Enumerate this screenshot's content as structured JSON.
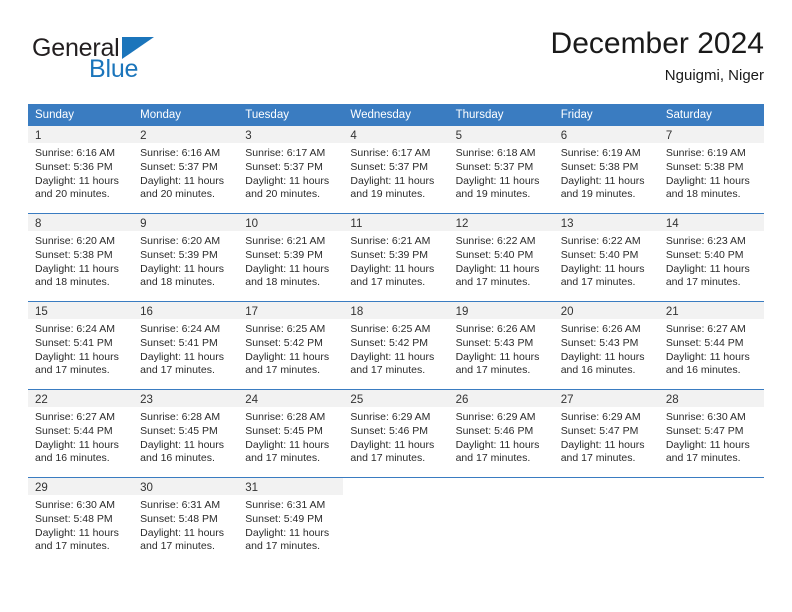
{
  "brand": {
    "name_part1": "General",
    "name_part2": "Blue",
    "color_dark": "#231f20",
    "color_blue": "#1b75bb"
  },
  "header": {
    "title": "December 2024",
    "subtitle": "Nguigmi, Niger"
  },
  "calendar": {
    "header_bg": "#3a7cc1",
    "daynum_bg": "#f2f2f2",
    "weekdays": [
      "Sunday",
      "Monday",
      "Tuesday",
      "Wednesday",
      "Thursday",
      "Friday",
      "Saturday"
    ],
    "weeks": [
      [
        {
          "day": "1",
          "sunrise": "Sunrise: 6:16 AM",
          "sunset": "Sunset: 5:36 PM",
          "daylight1": "Daylight: 11 hours",
          "daylight2": "and 20 minutes."
        },
        {
          "day": "2",
          "sunrise": "Sunrise: 6:16 AM",
          "sunset": "Sunset: 5:37 PM",
          "daylight1": "Daylight: 11 hours",
          "daylight2": "and 20 minutes."
        },
        {
          "day": "3",
          "sunrise": "Sunrise: 6:17 AM",
          "sunset": "Sunset: 5:37 PM",
          "daylight1": "Daylight: 11 hours",
          "daylight2": "and 20 minutes."
        },
        {
          "day": "4",
          "sunrise": "Sunrise: 6:17 AM",
          "sunset": "Sunset: 5:37 PM",
          "daylight1": "Daylight: 11 hours",
          "daylight2": "and 19 minutes."
        },
        {
          "day": "5",
          "sunrise": "Sunrise: 6:18 AM",
          "sunset": "Sunset: 5:37 PM",
          "daylight1": "Daylight: 11 hours",
          "daylight2": "and 19 minutes."
        },
        {
          "day": "6",
          "sunrise": "Sunrise: 6:19 AM",
          "sunset": "Sunset: 5:38 PM",
          "daylight1": "Daylight: 11 hours",
          "daylight2": "and 19 minutes."
        },
        {
          "day": "7",
          "sunrise": "Sunrise: 6:19 AM",
          "sunset": "Sunset: 5:38 PM",
          "daylight1": "Daylight: 11 hours",
          "daylight2": "and 18 minutes."
        }
      ],
      [
        {
          "day": "8",
          "sunrise": "Sunrise: 6:20 AM",
          "sunset": "Sunset: 5:38 PM",
          "daylight1": "Daylight: 11 hours",
          "daylight2": "and 18 minutes."
        },
        {
          "day": "9",
          "sunrise": "Sunrise: 6:20 AM",
          "sunset": "Sunset: 5:39 PM",
          "daylight1": "Daylight: 11 hours",
          "daylight2": "and 18 minutes."
        },
        {
          "day": "10",
          "sunrise": "Sunrise: 6:21 AM",
          "sunset": "Sunset: 5:39 PM",
          "daylight1": "Daylight: 11 hours",
          "daylight2": "and 18 minutes."
        },
        {
          "day": "11",
          "sunrise": "Sunrise: 6:21 AM",
          "sunset": "Sunset: 5:39 PM",
          "daylight1": "Daylight: 11 hours",
          "daylight2": "and 17 minutes."
        },
        {
          "day": "12",
          "sunrise": "Sunrise: 6:22 AM",
          "sunset": "Sunset: 5:40 PM",
          "daylight1": "Daylight: 11 hours",
          "daylight2": "and 17 minutes."
        },
        {
          "day": "13",
          "sunrise": "Sunrise: 6:22 AM",
          "sunset": "Sunset: 5:40 PM",
          "daylight1": "Daylight: 11 hours",
          "daylight2": "and 17 minutes."
        },
        {
          "day": "14",
          "sunrise": "Sunrise: 6:23 AM",
          "sunset": "Sunset: 5:40 PM",
          "daylight1": "Daylight: 11 hours",
          "daylight2": "and 17 minutes."
        }
      ],
      [
        {
          "day": "15",
          "sunrise": "Sunrise: 6:24 AM",
          "sunset": "Sunset: 5:41 PM",
          "daylight1": "Daylight: 11 hours",
          "daylight2": "and 17 minutes."
        },
        {
          "day": "16",
          "sunrise": "Sunrise: 6:24 AM",
          "sunset": "Sunset: 5:41 PM",
          "daylight1": "Daylight: 11 hours",
          "daylight2": "and 17 minutes."
        },
        {
          "day": "17",
          "sunrise": "Sunrise: 6:25 AM",
          "sunset": "Sunset: 5:42 PM",
          "daylight1": "Daylight: 11 hours",
          "daylight2": "and 17 minutes."
        },
        {
          "day": "18",
          "sunrise": "Sunrise: 6:25 AM",
          "sunset": "Sunset: 5:42 PM",
          "daylight1": "Daylight: 11 hours",
          "daylight2": "and 17 minutes."
        },
        {
          "day": "19",
          "sunrise": "Sunrise: 6:26 AM",
          "sunset": "Sunset: 5:43 PM",
          "daylight1": "Daylight: 11 hours",
          "daylight2": "and 17 minutes."
        },
        {
          "day": "20",
          "sunrise": "Sunrise: 6:26 AM",
          "sunset": "Sunset: 5:43 PM",
          "daylight1": "Daylight: 11 hours",
          "daylight2": "and 16 minutes."
        },
        {
          "day": "21",
          "sunrise": "Sunrise: 6:27 AM",
          "sunset": "Sunset: 5:44 PM",
          "daylight1": "Daylight: 11 hours",
          "daylight2": "and 16 minutes."
        }
      ],
      [
        {
          "day": "22",
          "sunrise": "Sunrise: 6:27 AM",
          "sunset": "Sunset: 5:44 PM",
          "daylight1": "Daylight: 11 hours",
          "daylight2": "and 16 minutes."
        },
        {
          "day": "23",
          "sunrise": "Sunrise: 6:28 AM",
          "sunset": "Sunset: 5:45 PM",
          "daylight1": "Daylight: 11 hours",
          "daylight2": "and 16 minutes."
        },
        {
          "day": "24",
          "sunrise": "Sunrise: 6:28 AM",
          "sunset": "Sunset: 5:45 PM",
          "daylight1": "Daylight: 11 hours",
          "daylight2": "and 17 minutes."
        },
        {
          "day": "25",
          "sunrise": "Sunrise: 6:29 AM",
          "sunset": "Sunset: 5:46 PM",
          "daylight1": "Daylight: 11 hours",
          "daylight2": "and 17 minutes."
        },
        {
          "day": "26",
          "sunrise": "Sunrise: 6:29 AM",
          "sunset": "Sunset: 5:46 PM",
          "daylight1": "Daylight: 11 hours",
          "daylight2": "and 17 minutes."
        },
        {
          "day": "27",
          "sunrise": "Sunrise: 6:29 AM",
          "sunset": "Sunset: 5:47 PM",
          "daylight1": "Daylight: 11 hours",
          "daylight2": "and 17 minutes."
        },
        {
          "day": "28",
          "sunrise": "Sunrise: 6:30 AM",
          "sunset": "Sunset: 5:47 PM",
          "daylight1": "Daylight: 11 hours",
          "daylight2": "and 17 minutes."
        }
      ],
      [
        {
          "day": "29",
          "sunrise": "Sunrise: 6:30 AM",
          "sunset": "Sunset: 5:48 PM",
          "daylight1": "Daylight: 11 hours",
          "daylight2": "and 17 minutes."
        },
        {
          "day": "30",
          "sunrise": "Sunrise: 6:31 AM",
          "sunset": "Sunset: 5:48 PM",
          "daylight1": "Daylight: 11 hours",
          "daylight2": "and 17 minutes."
        },
        {
          "day": "31",
          "sunrise": "Sunrise: 6:31 AM",
          "sunset": "Sunset: 5:49 PM",
          "daylight1": "Daylight: 11 hours",
          "daylight2": "and 17 minutes."
        },
        {
          "day": "",
          "sunrise": "",
          "sunset": "",
          "daylight1": "",
          "daylight2": ""
        },
        {
          "day": "",
          "sunrise": "",
          "sunset": "",
          "daylight1": "",
          "daylight2": ""
        },
        {
          "day": "",
          "sunrise": "",
          "sunset": "",
          "daylight1": "",
          "daylight2": ""
        },
        {
          "day": "",
          "sunrise": "",
          "sunset": "",
          "daylight1": "",
          "daylight2": ""
        }
      ]
    ]
  }
}
